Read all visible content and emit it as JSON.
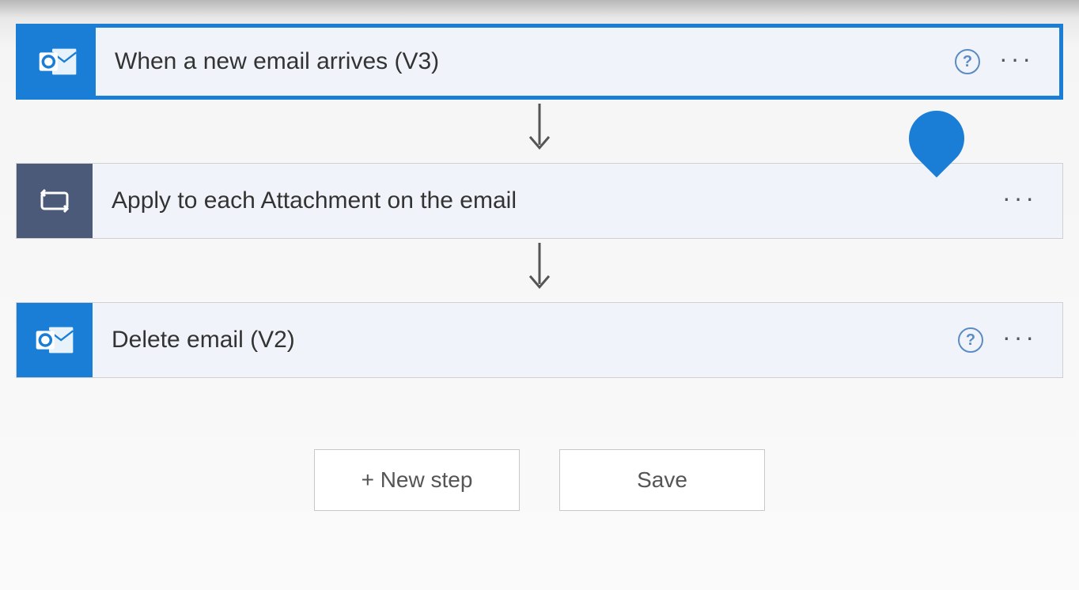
{
  "steps": [
    {
      "title": "When a new email arrives (V3)",
      "icon": "outlook",
      "selected": true,
      "showHelp": true
    },
    {
      "title": "Apply to each Attachment on the email",
      "icon": "control",
      "selected": false,
      "showHelp": false
    },
    {
      "title": "Delete email (V2)",
      "icon": "outlook",
      "selected": false,
      "showHelp": true
    }
  ],
  "buttons": {
    "newStep": "+ New step",
    "save": "Save"
  },
  "colors": {
    "accent": "#1b7ed6",
    "controlIcon": "#4a5a78"
  }
}
